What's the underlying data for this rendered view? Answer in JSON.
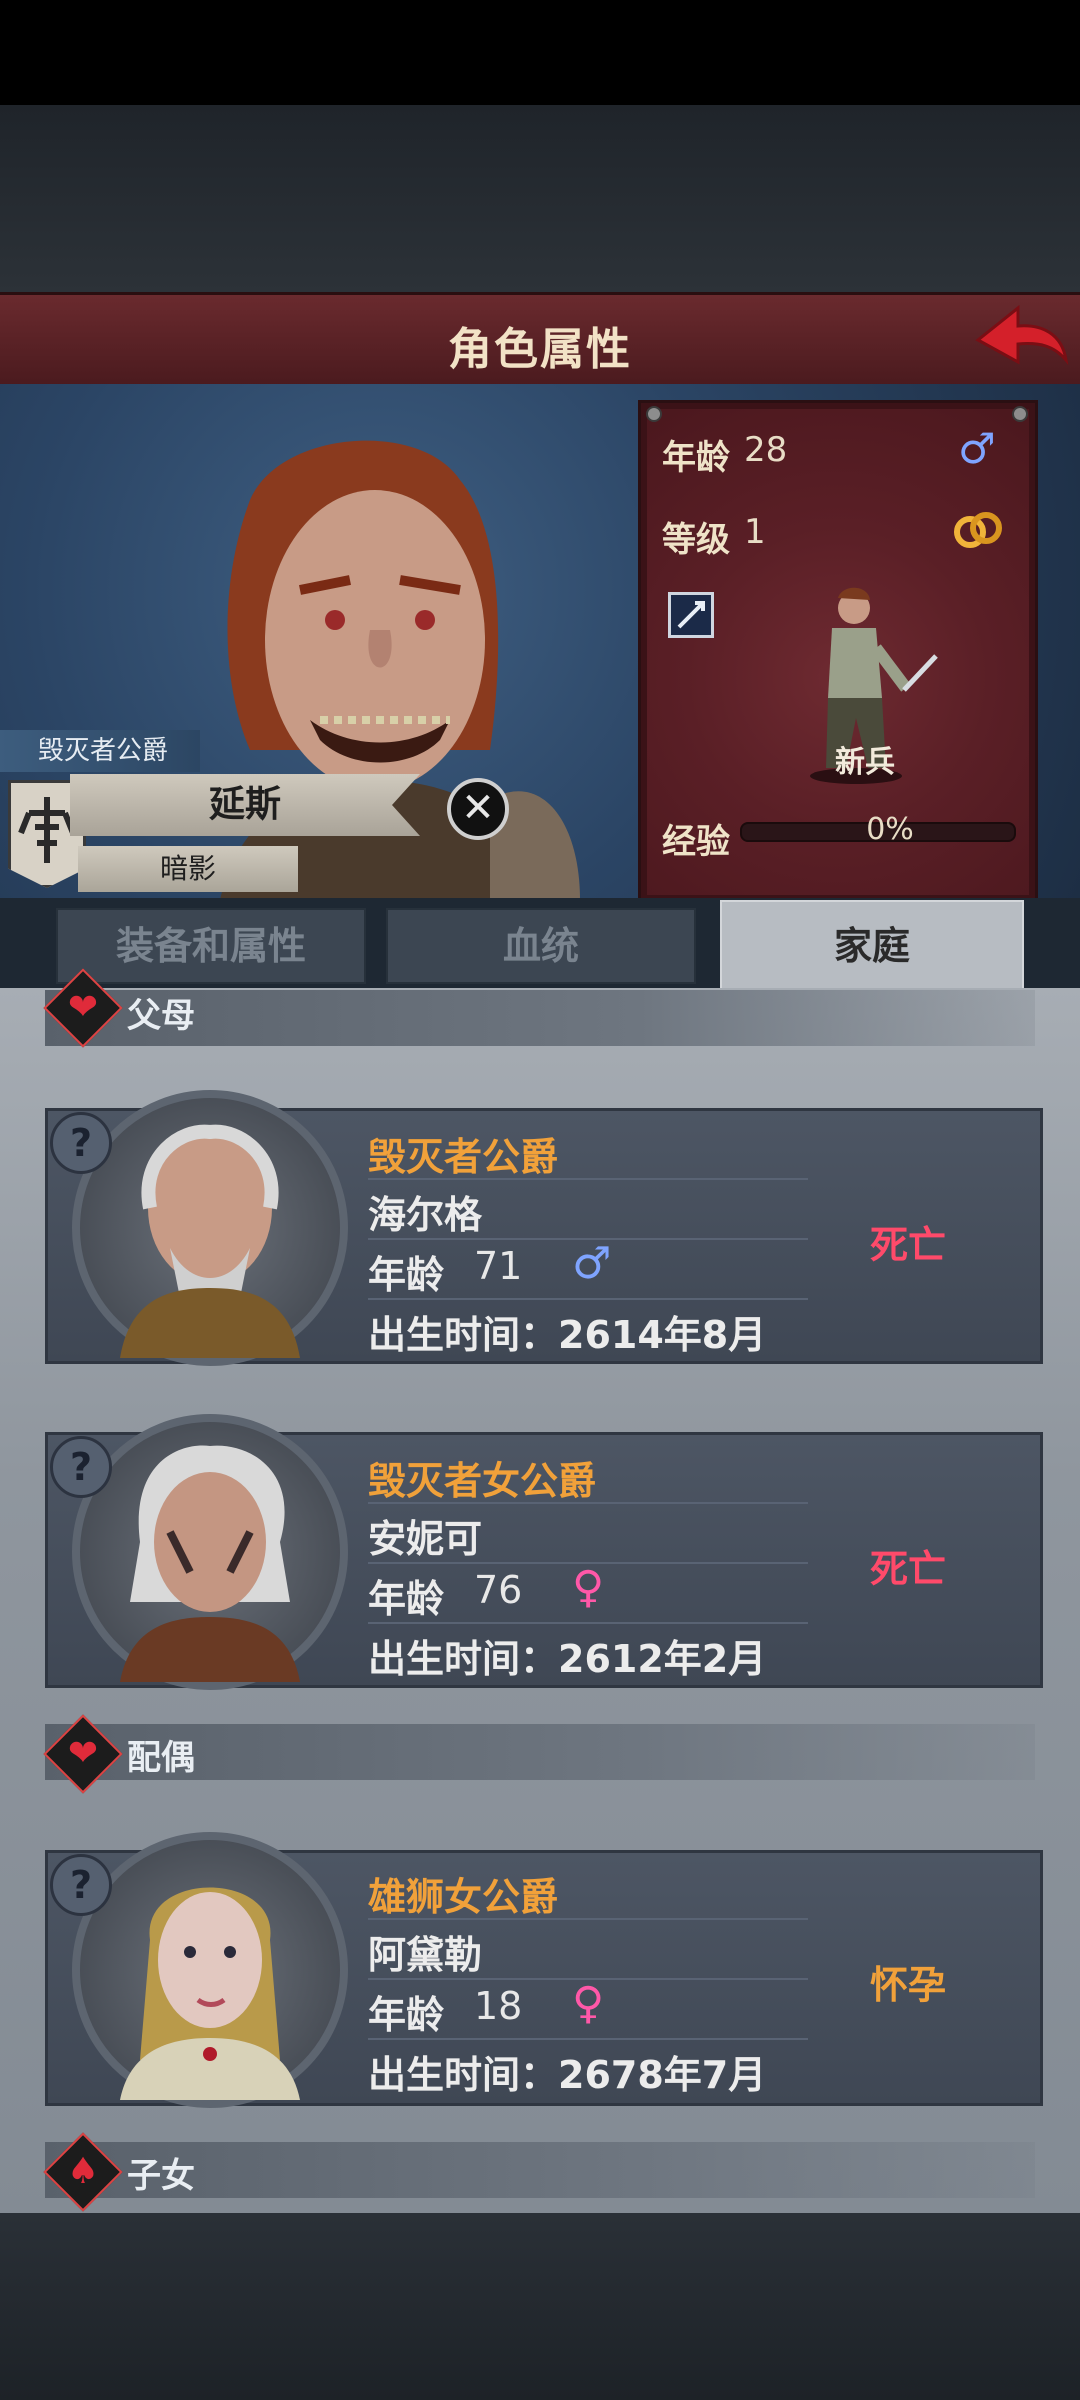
{
  "header": {
    "title": "角色属性"
  },
  "character": {
    "rank_title": "毁灭者公爵",
    "name": "延斯",
    "subtitle": "暗影",
    "stats": {
      "age_label": "年龄",
      "age": "28",
      "level_label": "等级",
      "level": "1",
      "unit_name": "新兵",
      "exp_label": "经验",
      "exp_percent": "0%",
      "exp_progress": 0.0
    }
  },
  "tabs": [
    {
      "label": "装备和属性",
      "active": false
    },
    {
      "label": "血统",
      "active": false
    },
    {
      "label": "家庭",
      "active": true
    }
  ],
  "sections": {
    "parents": "父母",
    "spouse": "配偶",
    "children": "子女"
  },
  "family": [
    {
      "title": "毁灭者公爵",
      "name": "海尔格",
      "age_label": "年龄",
      "age": "71",
      "gender": "male",
      "birth": "出生时间：2614年8月",
      "status": "死亡"
    },
    {
      "title": "毁灭者女公爵",
      "name": "安妮可",
      "age_label": "年龄",
      "age": "76",
      "gender": "female",
      "birth": "出生时间：2612年2月",
      "status": "死亡"
    },
    {
      "title": "雄狮女公爵",
      "name": "阿黛勒",
      "age_label": "年龄",
      "age": "18",
      "gender": "female",
      "birth": "出生时间：2678年7月",
      "status": "怀孕"
    }
  ],
  "colors": {
    "title_bar": "#5a2026",
    "orange_text": "#f1a13a",
    "dead_status": "#ff4a6a",
    "male_symbol": "#7fa4ff",
    "female_symbol": "#ff58a8"
  },
  "icons": {
    "male": "♂",
    "female": "♀",
    "help": "?",
    "close": "✕",
    "heart": "❤",
    "spade": "♠"
  }
}
